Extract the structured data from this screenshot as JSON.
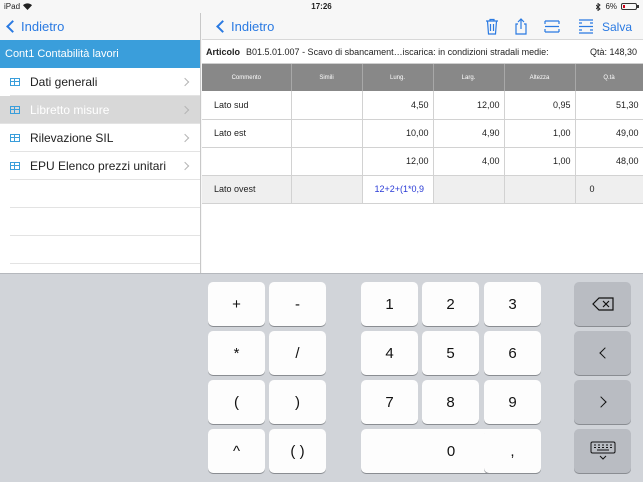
{
  "status_bar": {
    "device": "iPad",
    "time": "17:26",
    "battery": "6%"
  },
  "master": {
    "back_label": "Indietro",
    "section_title": "Cont1 Contabilità lavori",
    "items": [
      {
        "label": "Dati generali",
        "selected": false
      },
      {
        "label": "Libretto misure",
        "selected": true
      },
      {
        "label": "Rilevazione SIL",
        "selected": false
      },
      {
        "label": "EPU Elenco prezzi unitari",
        "selected": false
      }
    ]
  },
  "detail": {
    "back_label": "Indietro",
    "save_label": "Salva",
    "toolbar_icons": [
      "trash-icon",
      "share-icon",
      "rows-icon",
      "rows-expand-icon"
    ],
    "articolo": {
      "label": "Articolo",
      "text": "B01.5.01.007 - Scavo di sbancament…iscarica: in condizioni stradali medie:",
      "qta": "Qtà: 148,30"
    },
    "columns": [
      "Commento",
      "Simili",
      "Lung.",
      "Larg.",
      "Altezza",
      "Q.tà"
    ],
    "rows": [
      {
        "commento": "Lato sud",
        "simili": "",
        "lung": "4,50",
        "larg": "12,00",
        "altezza": "0,95",
        "qta": "51,30"
      },
      {
        "commento": "Lato est",
        "simili": "",
        "lung": "10,00",
        "larg": "4,90",
        "altezza": "1,00",
        "qta": "49,00"
      },
      {
        "commento": "",
        "simili": "",
        "lung": "12,00",
        "larg": "4,00",
        "altezza": "1,00",
        "qta": "48,00"
      },
      {
        "commento": "Lato ovest",
        "simili": "",
        "lung": "12+2+(1*0,9",
        "larg": "",
        "altezza": "",
        "qta": "0"
      }
    ]
  },
  "keyboard": {
    "keys": {
      "plus": "+",
      "minus": "-",
      "times": "*",
      "divide": "/",
      "open_paren": "(",
      "close_paren": ")",
      "caret": "^",
      "parens": "( )",
      "one": "1",
      "two": "2",
      "three": "3",
      "four": "4",
      "five": "5",
      "six": "6",
      "seven": "7",
      "eight": "8",
      "nine": "9",
      "zero": "0",
      "comma": ","
    }
  }
}
